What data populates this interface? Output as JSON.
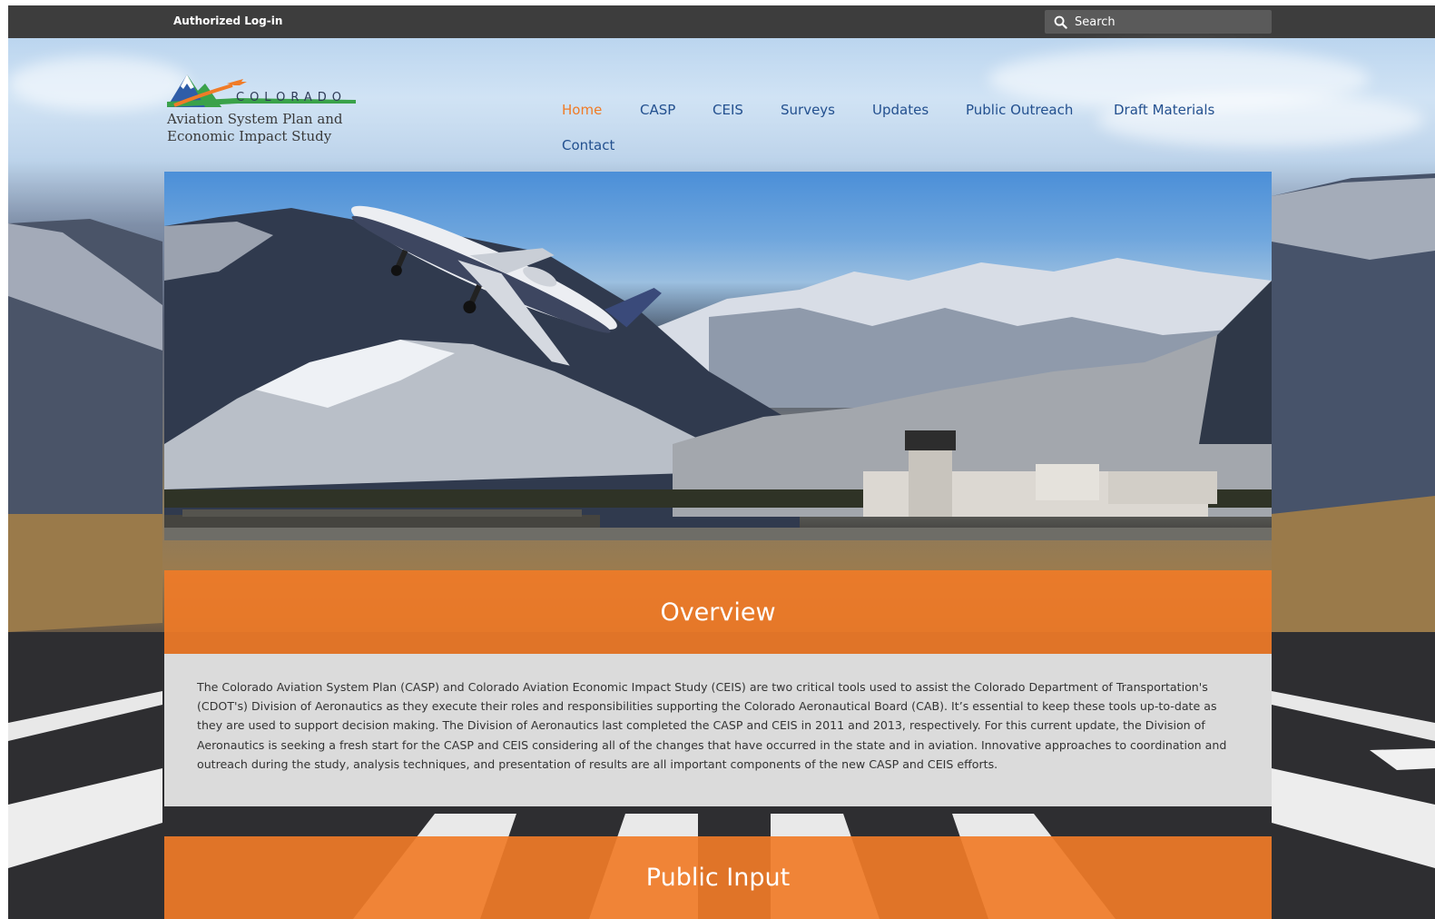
{
  "topbar": {
    "login_label": "Authorized Log-in",
    "search_placeholder": "Search"
  },
  "logo": {
    "wordmark": "COLORADO",
    "line1": "Aviation System Plan and",
    "line2": "Economic Impact Study"
  },
  "nav": {
    "items": [
      {
        "label": "Home",
        "active": true
      },
      {
        "label": "CASP",
        "active": false
      },
      {
        "label": "CEIS",
        "active": false
      },
      {
        "label": "Surveys",
        "active": false
      },
      {
        "label": "Updates",
        "active": false
      },
      {
        "label": "Public Outreach",
        "active": false
      },
      {
        "label": "Draft Materials",
        "active": false
      },
      {
        "label": "Contact",
        "active": false
      }
    ]
  },
  "overview": {
    "heading": "Overview",
    "body": "The Colorado Aviation System Plan (CASP) and Colorado Aviation Economic Impact Study (CEIS) are two critical tools used to assist the Colorado Department of Transportation's (CDOT's) Division of Aeronautics as they execute their roles and responsibilities supporting the Colorado Aeronautical Board (CAB). It’s essential to keep these tools up-to-date as they are used to support decision making. The Division of Aeronautics last completed the CASP and CEIS in 2011 and 2013, respectively. For this current update, the Division of Aeronautics is seeking a fresh start for the CASP and CEIS considering all of the changes that have occurred in the state and in aviation. Innovative approaches to coordination and outreach during the study, analysis techniques, and presentation of results are all important components of the new CASP and CEIS efforts."
  },
  "public_input": {
    "heading": "Public Input"
  },
  "colors": {
    "accent_orange": "#f07b27",
    "nav_blue": "#23508f",
    "topbar": "#3d3d3d"
  },
  "icons": {
    "search": "search-icon",
    "logo": "mountain-plane-logo-icon"
  }
}
